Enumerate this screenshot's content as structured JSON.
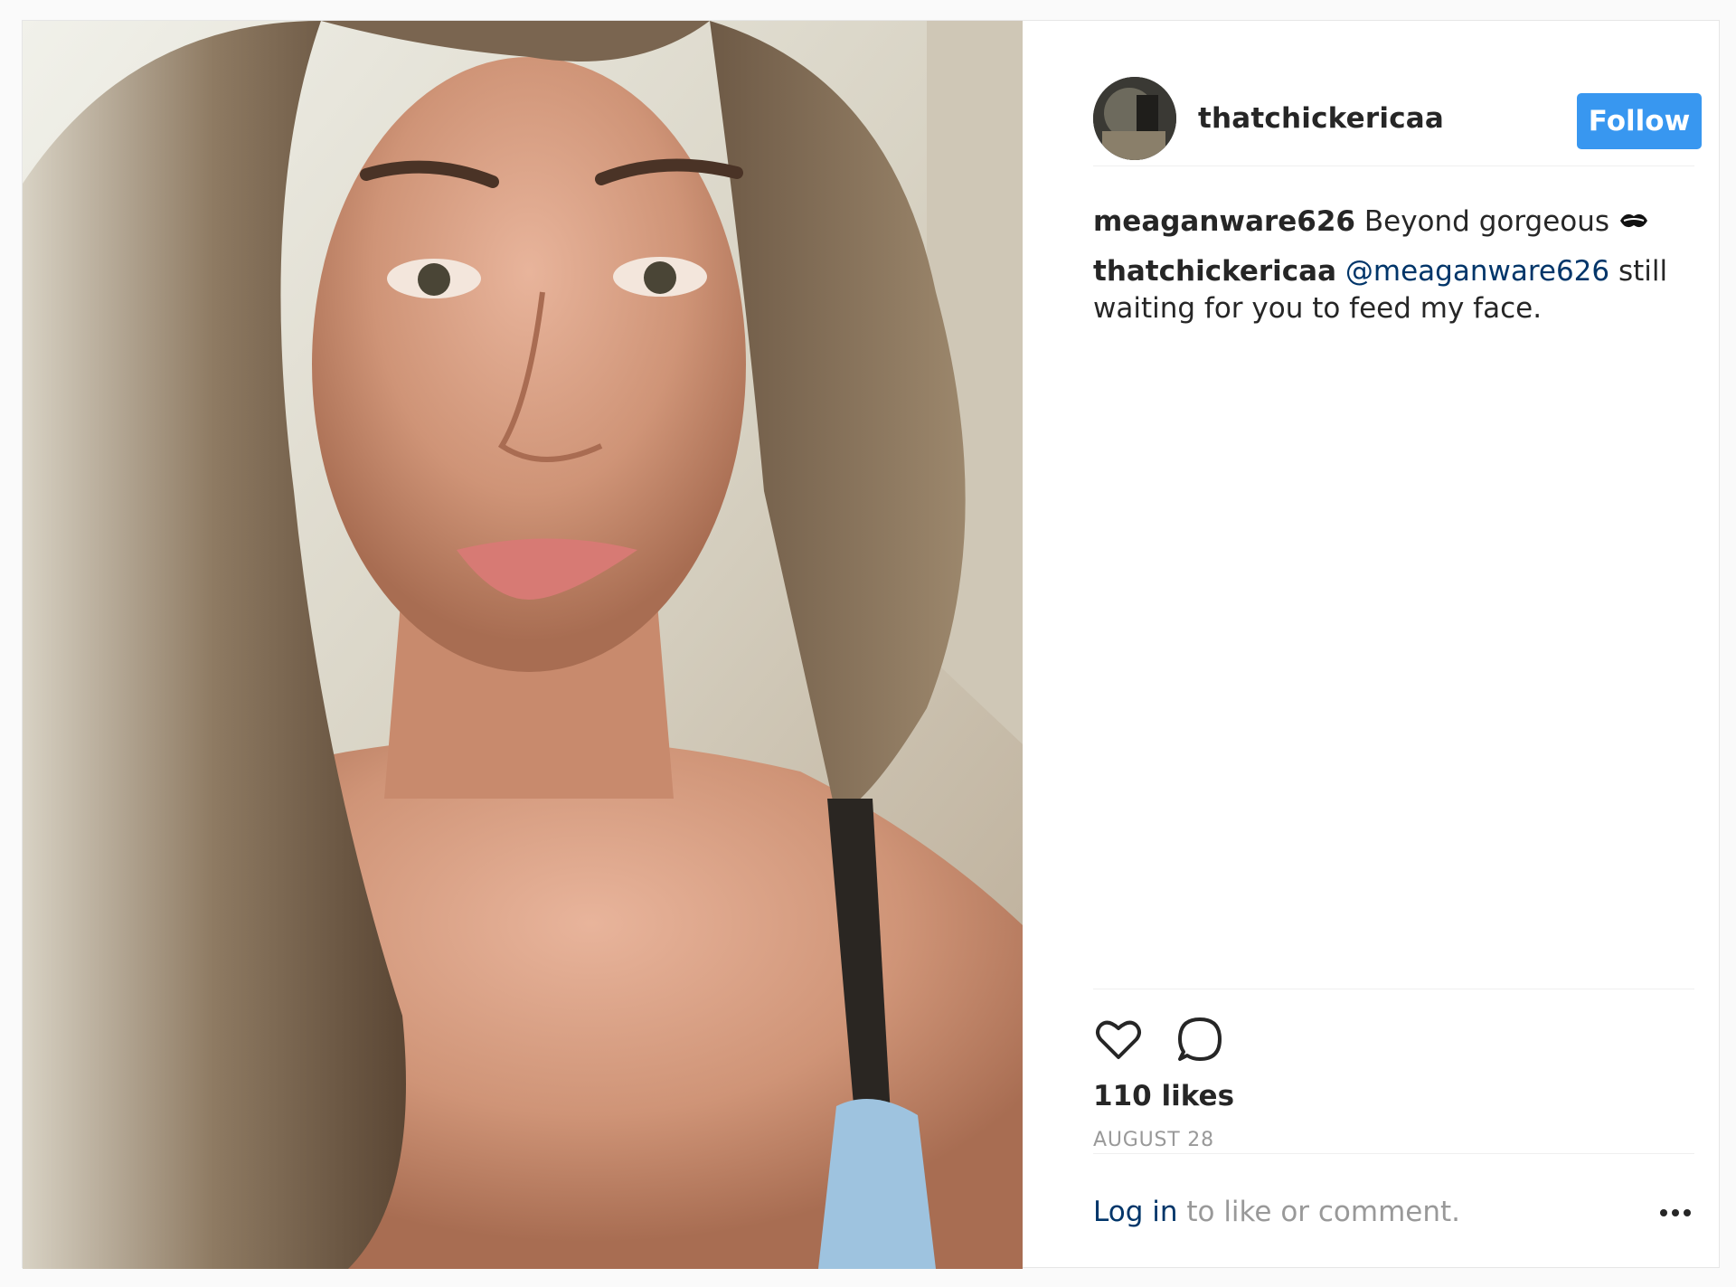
{
  "post": {
    "author": "thatchickericaa",
    "follow_label": "Follow",
    "comments": [
      {
        "user": "meaganware626",
        "text": "Beyond gorgeous",
        "emoji": "kiss-mark-icon"
      },
      {
        "user": "thatchickericaa",
        "mention": "@meaganware626",
        "text": "still waiting for you to feed my face."
      }
    ],
    "likes": "110 likes",
    "date": "AUGUST 28",
    "login_link": "Log in",
    "login_rest": "to like or comment."
  },
  "colors": {
    "accent": "#3897f0",
    "link": "#003569",
    "muted": "#999999",
    "text": "#262626"
  },
  "icons": [
    "heart-icon",
    "comment-icon",
    "more-options-icon",
    "kiss-mark-icon"
  ]
}
